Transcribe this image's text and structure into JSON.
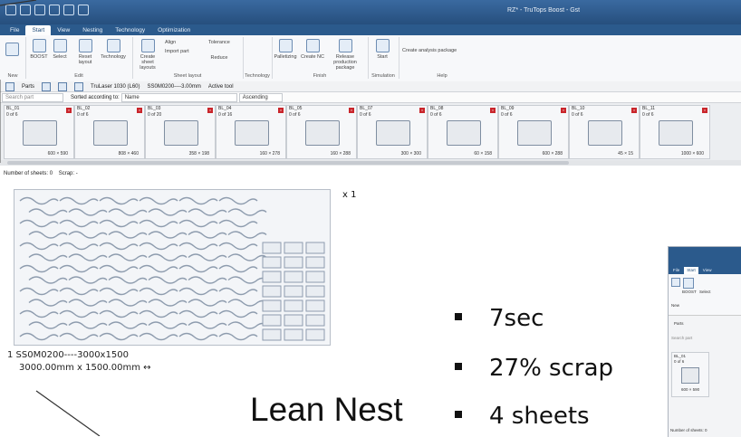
{
  "window": {
    "title": "RZ* - TruTops Boost - Gst"
  },
  "menu_tabs": [
    {
      "label": "File",
      "active": false
    },
    {
      "label": "Start",
      "active": true
    },
    {
      "label": "View",
      "active": false
    },
    {
      "label": "Nesting",
      "active": false
    },
    {
      "label": "Technology",
      "active": false
    },
    {
      "label": "Optimization",
      "active": false
    }
  ],
  "ribbon": {
    "groups": {
      "new": "New",
      "edit": "Edit",
      "sheet_layout": "Sheet layout",
      "technology": "Technology",
      "finish": "Finish",
      "simulation": "Simulation",
      "help": "Help"
    },
    "buttons": {
      "boost": "BOOST",
      "select": "Select",
      "reset": "Reset layout",
      "technology": "Technology",
      "create_sheet": "Create sheet layouts",
      "align": "Align",
      "import_part": "Import part",
      "reduce": "Reduce",
      "tolerance": "Tolerance",
      "palletizing": "Palletizing",
      "create_nc": "Create NC",
      "release": "Release production package",
      "start": "Start",
      "analysis": "Create analysis package"
    }
  },
  "parts_toolbar": {
    "parts_label": "Parts",
    "format_label": "TruLaser 1030 (L60)",
    "material_label": "SS0M0200----3.00mm",
    "active_label": "Active tool"
  },
  "search": {
    "placeholder": "Search part",
    "sort_label": "Sorted according to:",
    "sort_value": "Name",
    "order_value": "Ascending"
  },
  "parts": [
    {
      "id": "BL_01",
      "count": "0 of 6",
      "dim": "600 × 590"
    },
    {
      "id": "BL_02",
      "count": "0 of 6",
      "dim": "808 × 460"
    },
    {
      "id": "BL_03",
      "count": "0 of 20",
      "dim": "358 × 198"
    },
    {
      "id": "BL_04",
      "count": "0 of 16",
      "dim": "160 × 278"
    },
    {
      "id": "BL_05",
      "count": "0 of 6",
      "dim": "160 × 288"
    },
    {
      "id": "BL_07",
      "count": "0 of 6",
      "dim": "300 × 300"
    },
    {
      "id": "BL_08",
      "count": "0 of 6",
      "dim": "60 × 158"
    },
    {
      "id": "BL_09",
      "count": "0 of 6",
      "dim": "600 × 288"
    },
    {
      "id": "BL_10",
      "count": "0 of 6",
      "dim": "45 × 15"
    },
    {
      "id": "BL_11",
      "count": "0 of 6",
      "dim": "1000 × 600"
    }
  ],
  "sheet_summary": {
    "label": "Number of sheets:",
    "value": "0",
    "scrap_label": "Scrap:",
    "scrap_value": "-"
  },
  "sheet": {
    "multiplier": "x 1",
    "label": "1 SS0M0200----3000x1500",
    "dimensions": "3000.00mm x 1500.00mm ↔"
  },
  "results": {
    "title": "Lean Nest",
    "bullets": [
      "7sec",
      "27% scrap",
      "4 sheets"
    ]
  },
  "inset": {
    "tabs": [
      "File",
      "Start",
      "View"
    ],
    "boost": "BOOST",
    "select": "Select",
    "new": "New",
    "parts": "Parts",
    "search": "Search part",
    "card_id": "BL_01",
    "card_count": "0 of 6",
    "card_dim": "600 × 590",
    "sheets_label": "Number of sheets: 0"
  },
  "colors": {
    "title_bar": "#2b5a8c",
    "badge_red": "#c9252b",
    "text_dark": "#111111"
  }
}
